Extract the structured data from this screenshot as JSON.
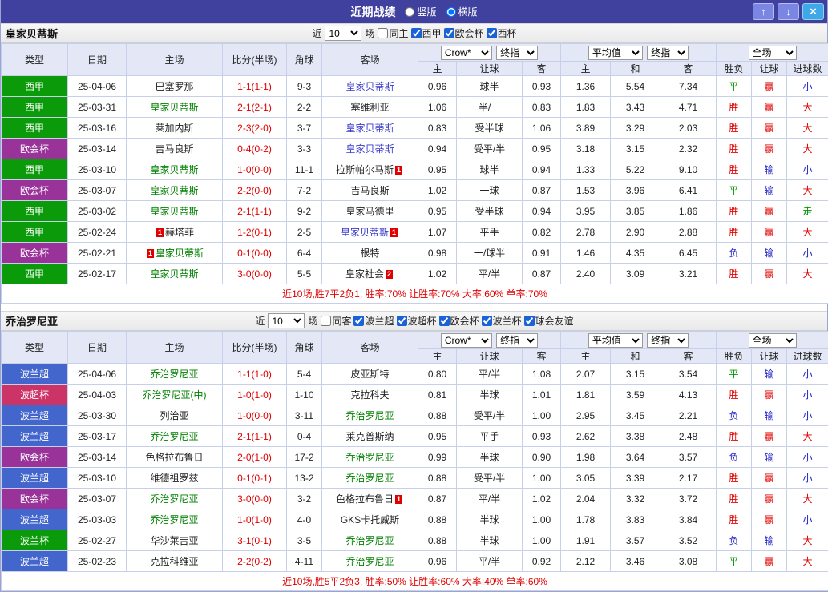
{
  "titlebar": {
    "title": "近期战绩",
    "radios": [
      {
        "label": "竖版",
        "checked": false
      },
      {
        "label": "横版",
        "checked": true
      }
    ],
    "buttons": {
      "up": "↑",
      "down": "↓",
      "close": "×"
    }
  },
  "palette": {
    "red": "#e10000",
    "blue": "#2424c8",
    "green": "#009900",
    "black": "#222222",
    "score": "#e10000",
    "homeTeam": "#008000",
    "awayTeam": "#3a3ac8",
    "lgGreen": "#0a9a0a",
    "lgPurple": "#993399",
    "lgBlue": "#4366cc",
    "lgCrimson": "#cc3366",
    "card": "#e10000"
  },
  "columns": {
    "type": "类型",
    "date": "日期",
    "home": "主场",
    "score": "比分(半场)",
    "corner": "角球",
    "away": "客场",
    "odds_home": "主",
    "odds_handicap": "让球",
    "odds_away": "客",
    "avg_home": "主",
    "avg_draw": "和",
    "avg_away": "客",
    "result": "胜负",
    "handicap": "让球",
    "goals": "进球数"
  },
  "sections": [
    {
      "team": "皇家贝蒂斯",
      "controls": {
        "near": "近",
        "count": "10",
        "games": "场",
        "same": {
          "label": "同主",
          "checked": false
        },
        "leagues": [
          {
            "label": "西甲",
            "checked": true
          },
          {
            "label": "欧会杯",
            "checked": true
          },
          {
            "label": "西杯",
            "checked": true
          }
        ]
      },
      "dropdowns": {
        "company": "Crow*",
        "company_ref": "终指",
        "average": "平均值",
        "average_ref": "终指",
        "scope": "全场"
      },
      "rows": [
        {
          "league": {
            "v": "西甲",
            "c": "lgGreen"
          },
          "date": "25-04-06",
          "home": {
            "v": "巴塞罗那",
            "c": "black",
            "card": ""
          },
          "score": "1-1(1-1)",
          "corner": "9-3",
          "away": {
            "v": "皇家贝蒂斯",
            "c": "awayTeam",
            "card": ""
          },
          "odds": [
            "0.96",
            "球半",
            "0.93"
          ],
          "avg": [
            "1.36",
            "5.54",
            "7.34"
          ],
          "result": {
            "v": "平",
            "c": "green"
          },
          "handicap": {
            "v": "赢",
            "c": "red"
          },
          "goal": {
            "v": "小",
            "c": "blue"
          }
        },
        {
          "league": {
            "v": "西甲",
            "c": "lgGreen"
          },
          "date": "25-03-31",
          "home": {
            "v": "皇家贝蒂斯",
            "c": "homeTeam",
            "card": ""
          },
          "score": "2-1(2-1)",
          "corner": "2-2",
          "away": {
            "v": "塞维利亚",
            "c": "black",
            "card": ""
          },
          "odds": [
            "1.06",
            "半/一",
            "0.83"
          ],
          "avg": [
            "1.83",
            "3.43",
            "4.71"
          ],
          "result": {
            "v": "胜",
            "c": "red"
          },
          "handicap": {
            "v": "赢",
            "c": "red"
          },
          "goal": {
            "v": "大",
            "c": "red"
          }
        },
        {
          "league": {
            "v": "西甲",
            "c": "lgGreen"
          },
          "date": "25-03-16",
          "home": {
            "v": "莱加内斯",
            "c": "black",
            "card": ""
          },
          "score": "2-3(2-0)",
          "corner": "3-7",
          "away": {
            "v": "皇家贝蒂斯",
            "c": "awayTeam",
            "card": ""
          },
          "odds": [
            "0.83",
            "受半球",
            "1.06"
          ],
          "avg": [
            "3.89",
            "3.29",
            "2.03"
          ],
          "result": {
            "v": "胜",
            "c": "red"
          },
          "handicap": {
            "v": "赢",
            "c": "red"
          },
          "goal": {
            "v": "大",
            "c": "red"
          }
        },
        {
          "league": {
            "v": "欧会杯",
            "c": "lgPurple"
          },
          "date": "25-03-14",
          "home": {
            "v": "吉马良斯",
            "c": "black",
            "card": ""
          },
          "score": "0-4(0-2)",
          "corner": "3-3",
          "away": {
            "v": "皇家贝蒂斯",
            "c": "awayTeam",
            "card": ""
          },
          "odds": [
            "0.94",
            "受平/半",
            "0.95"
          ],
          "avg": [
            "3.18",
            "3.15",
            "2.32"
          ],
          "result": {
            "v": "胜",
            "c": "red"
          },
          "handicap": {
            "v": "赢",
            "c": "red"
          },
          "goal": {
            "v": "大",
            "c": "red"
          }
        },
        {
          "league": {
            "v": "西甲",
            "c": "lgGreen"
          },
          "date": "25-03-10",
          "home": {
            "v": "皇家贝蒂斯",
            "c": "homeTeam",
            "card": ""
          },
          "score": "1-0(0-0)",
          "corner": "11-1",
          "away": {
            "v": "拉斯帕尔马斯",
            "c": "black",
            "card": "1"
          },
          "odds": [
            "0.95",
            "球半",
            "0.94"
          ],
          "avg": [
            "1.33",
            "5.22",
            "9.10"
          ],
          "result": {
            "v": "胜",
            "c": "red"
          },
          "handicap": {
            "v": "输",
            "c": "blue"
          },
          "goal": {
            "v": "小",
            "c": "blue"
          }
        },
        {
          "league": {
            "v": "欧会杯",
            "c": "lgPurple"
          },
          "date": "25-03-07",
          "home": {
            "v": "皇家贝蒂斯",
            "c": "homeTeam",
            "card": ""
          },
          "score": "2-2(0-0)",
          "corner": "7-2",
          "away": {
            "v": "吉马良斯",
            "c": "black",
            "card": ""
          },
          "odds": [
            "1.02",
            "一球",
            "0.87"
          ],
          "avg": [
            "1.53",
            "3.96",
            "6.41"
          ],
          "result": {
            "v": "平",
            "c": "green"
          },
          "handicap": {
            "v": "输",
            "c": "blue"
          },
          "goal": {
            "v": "大",
            "c": "red"
          }
        },
        {
          "league": {
            "v": "西甲",
            "c": "lgGreen"
          },
          "date": "25-03-02",
          "home": {
            "v": "皇家贝蒂斯",
            "c": "homeTeam",
            "card": ""
          },
          "score": "2-1(1-1)",
          "corner": "9-2",
          "away": {
            "v": "皇家马德里",
            "c": "black",
            "card": ""
          },
          "odds": [
            "0.95",
            "受半球",
            "0.94"
          ],
          "avg": [
            "3.95",
            "3.85",
            "1.86"
          ],
          "result": {
            "v": "胜",
            "c": "red"
          },
          "handicap": {
            "v": "赢",
            "c": "red"
          },
          "goal": {
            "v": "走",
            "c": "green"
          }
        },
        {
          "league": {
            "v": "西甲",
            "c": "lgGreen"
          },
          "date": "25-02-24",
          "home": {
            "v": "赫塔菲",
            "c": "black",
            "card": "1"
          },
          "score": "1-2(0-1)",
          "corner": "2-5",
          "away": {
            "v": "皇家贝蒂斯",
            "c": "awayTeam",
            "card": "1"
          },
          "odds": [
            "1.07",
            "平手",
            "0.82"
          ],
          "avg": [
            "2.78",
            "2.90",
            "2.88"
          ],
          "result": {
            "v": "胜",
            "c": "red"
          },
          "handicap": {
            "v": "赢",
            "c": "red"
          },
          "goal": {
            "v": "大",
            "c": "red"
          }
        },
        {
          "league": {
            "v": "欧会杯",
            "c": "lgPurple"
          },
          "date": "25-02-21",
          "home": {
            "v": "皇家贝蒂斯",
            "c": "homeTeam",
            "card": "1"
          },
          "score": "0-1(0-0)",
          "corner": "6-4",
          "away": {
            "v": "根特",
            "c": "black",
            "card": ""
          },
          "odds": [
            "0.98",
            "一/球半",
            "0.91"
          ],
          "avg": [
            "1.46",
            "4.35",
            "6.45"
          ],
          "result": {
            "v": "负",
            "c": "blue"
          },
          "handicap": {
            "v": "输",
            "c": "blue"
          },
          "goal": {
            "v": "小",
            "c": "blue"
          }
        },
        {
          "league": {
            "v": "西甲",
            "c": "lgGreen"
          },
          "date": "25-02-17",
          "home": {
            "v": "皇家贝蒂斯",
            "c": "homeTeam",
            "card": ""
          },
          "score": "3-0(0-0)",
          "corner": "5-5",
          "away": {
            "v": "皇家社会",
            "c": "black",
            "card": "2"
          },
          "odds": [
            "1.02",
            "平/半",
            "0.87"
          ],
          "avg": [
            "2.40",
            "3.09",
            "3.21"
          ],
          "result": {
            "v": "胜",
            "c": "red"
          },
          "handicap": {
            "v": "赢",
            "c": "red"
          },
          "goal": {
            "v": "大",
            "c": "red"
          }
        }
      ],
      "summary": "近10场,胜7平2负1, 胜率:70% 让胜率:70% 大率:60% 单率:70%"
    },
    {
      "team": "乔治罗尼亚",
      "controls": {
        "near": "近",
        "count": "10",
        "games": "场",
        "same": {
          "label": "同客",
          "checked": false
        },
        "leagues": [
          {
            "label": "波兰超",
            "checked": true
          },
          {
            "label": "波超杯",
            "checked": true
          },
          {
            "label": "欧会杯",
            "checked": true
          },
          {
            "label": "波兰杯",
            "checked": true
          },
          {
            "label": "球会友谊",
            "checked": true
          }
        ]
      },
      "dropdowns": {
        "company": "Crow*",
        "company_ref": "终指",
        "average": "平均值",
        "average_ref": "终指",
        "scope": "全场"
      },
      "rows": [
        {
          "league": {
            "v": "波兰超",
            "c": "lgBlue"
          },
          "date": "25-04-06",
          "home": {
            "v": "乔治罗尼亚",
            "c": "homeTeam",
            "card": ""
          },
          "score": "1-1(1-0)",
          "corner": "5-4",
          "away": {
            "v": "皮亚斯特",
            "c": "black",
            "card": ""
          },
          "odds": [
            "0.80",
            "平/半",
            "1.08"
          ],
          "avg": [
            "2.07",
            "3.15",
            "3.54"
          ],
          "result": {
            "v": "平",
            "c": "green"
          },
          "handicap": {
            "v": "输",
            "c": "blue"
          },
          "goal": {
            "v": "小",
            "c": "blue"
          }
        },
        {
          "league": {
            "v": "波超杯",
            "c": "lgCrimson"
          },
          "date": "25-04-03",
          "home": {
            "v": "乔治罗尼亚(中)",
            "c": "homeTeam",
            "card": ""
          },
          "score": "1-0(1-0)",
          "corner": "1-10",
          "away": {
            "v": "克拉科夫",
            "c": "black",
            "card": ""
          },
          "odds": [
            "0.81",
            "半球",
            "1.01"
          ],
          "avg": [
            "1.81",
            "3.59",
            "4.13"
          ],
          "result": {
            "v": "胜",
            "c": "red"
          },
          "handicap": {
            "v": "赢",
            "c": "red"
          },
          "goal": {
            "v": "小",
            "c": "blue"
          }
        },
        {
          "league": {
            "v": "波兰超",
            "c": "lgBlue"
          },
          "date": "25-03-30",
          "home": {
            "v": "列治亚",
            "c": "black",
            "card": ""
          },
          "score": "1-0(0-0)",
          "corner": "3-11",
          "away": {
            "v": "乔治罗尼亚",
            "c": "homeTeam",
            "card": ""
          },
          "odds": [
            "0.88",
            "受平/半",
            "1.00"
          ],
          "avg": [
            "2.95",
            "3.45",
            "2.21"
          ],
          "result": {
            "v": "负",
            "c": "blue"
          },
          "handicap": {
            "v": "输",
            "c": "blue"
          },
          "goal": {
            "v": "小",
            "c": "blue"
          }
        },
        {
          "league": {
            "v": "波兰超",
            "c": "lgBlue"
          },
          "date": "25-03-17",
          "home": {
            "v": "乔治罗尼亚",
            "c": "homeTeam",
            "card": ""
          },
          "score": "2-1(1-1)",
          "corner": "0-4",
          "away": {
            "v": "莱克普斯纳",
            "c": "black",
            "card": ""
          },
          "odds": [
            "0.95",
            "平手",
            "0.93"
          ],
          "avg": [
            "2.62",
            "3.38",
            "2.48"
          ],
          "result": {
            "v": "胜",
            "c": "red"
          },
          "handicap": {
            "v": "赢",
            "c": "red"
          },
          "goal": {
            "v": "大",
            "c": "red"
          }
        },
        {
          "league": {
            "v": "欧会杯",
            "c": "lgPurple"
          },
          "date": "25-03-14",
          "home": {
            "v": "色格拉布鲁日",
            "c": "black",
            "card": ""
          },
          "score": "2-0(1-0)",
          "corner": "17-2",
          "away": {
            "v": "乔治罗尼亚",
            "c": "homeTeam",
            "card": ""
          },
          "odds": [
            "0.99",
            "半球",
            "0.90"
          ],
          "avg": [
            "1.98",
            "3.64",
            "3.57"
          ],
          "result": {
            "v": "负",
            "c": "blue"
          },
          "handicap": {
            "v": "输",
            "c": "blue"
          },
          "goal": {
            "v": "小",
            "c": "blue"
          }
        },
        {
          "league": {
            "v": "波兰超",
            "c": "lgBlue"
          },
          "date": "25-03-10",
          "home": {
            "v": "维德祖罗兹",
            "c": "black",
            "card": ""
          },
          "score": "0-1(0-1)",
          "corner": "13-2",
          "away": {
            "v": "乔治罗尼亚",
            "c": "homeTeam",
            "card": ""
          },
          "odds": [
            "0.88",
            "受平/半",
            "1.00"
          ],
          "avg": [
            "3.05",
            "3.39",
            "2.17"
          ],
          "result": {
            "v": "胜",
            "c": "red"
          },
          "handicap": {
            "v": "赢",
            "c": "red"
          },
          "goal": {
            "v": "小",
            "c": "blue"
          }
        },
        {
          "league": {
            "v": "欧会杯",
            "c": "lgPurple"
          },
          "date": "25-03-07",
          "home": {
            "v": "乔治罗尼亚",
            "c": "homeTeam",
            "card": ""
          },
          "score": "3-0(0-0)",
          "corner": "3-2",
          "away": {
            "v": "色格拉布鲁日",
            "c": "black",
            "card": "1"
          },
          "odds": [
            "0.87",
            "平/半",
            "1.02"
          ],
          "avg": [
            "2.04",
            "3.32",
            "3.72"
          ],
          "result": {
            "v": "胜",
            "c": "red"
          },
          "handicap": {
            "v": "赢",
            "c": "red"
          },
          "goal": {
            "v": "大",
            "c": "red"
          }
        },
        {
          "league": {
            "v": "波兰超",
            "c": "lgBlue"
          },
          "date": "25-03-03",
          "home": {
            "v": "乔治罗尼亚",
            "c": "homeTeam",
            "card": ""
          },
          "score": "1-0(1-0)",
          "corner": "4-0",
          "away": {
            "v": "GKS卡托威斯",
            "c": "black",
            "card": ""
          },
          "odds": [
            "0.88",
            "半球",
            "1.00"
          ],
          "avg": [
            "1.78",
            "3.83",
            "3.84"
          ],
          "result": {
            "v": "胜",
            "c": "red"
          },
          "handicap": {
            "v": "赢",
            "c": "red"
          },
          "goal": {
            "v": "小",
            "c": "blue"
          }
        },
        {
          "league": {
            "v": "波兰杯",
            "c": "lgGreen"
          },
          "date": "25-02-27",
          "home": {
            "v": "华沙莱吉亚",
            "c": "black",
            "card": ""
          },
          "score": "3-1(0-1)",
          "corner": "3-5",
          "away": {
            "v": "乔治罗尼亚",
            "c": "homeTeam",
            "card": ""
          },
          "odds": [
            "0.88",
            "半球",
            "1.00"
          ],
          "avg": [
            "1.91",
            "3.57",
            "3.52"
          ],
          "result": {
            "v": "负",
            "c": "blue"
          },
          "handicap": {
            "v": "输",
            "c": "blue"
          },
          "goal": {
            "v": "大",
            "c": "red"
          }
        },
        {
          "league": {
            "v": "波兰超",
            "c": "lgBlue"
          },
          "date": "25-02-23",
          "home": {
            "v": "克拉科维亚",
            "c": "black",
            "card": ""
          },
          "score": "2-2(0-2)",
          "corner": "4-11",
          "away": {
            "v": "乔治罗尼亚",
            "c": "homeTeam",
            "card": ""
          },
          "odds": [
            "0.96",
            "平/半",
            "0.92"
          ],
          "avg": [
            "2.12",
            "3.46",
            "3.08"
          ],
          "result": {
            "v": "平",
            "c": "green"
          },
          "handicap": {
            "v": "赢",
            "c": "red"
          },
          "goal": {
            "v": "大",
            "c": "red"
          }
        }
      ],
      "summary": "近10场,胜5平2负3, 胜率:50% 让胜率:60% 大率:40% 单率:60%"
    }
  ]
}
